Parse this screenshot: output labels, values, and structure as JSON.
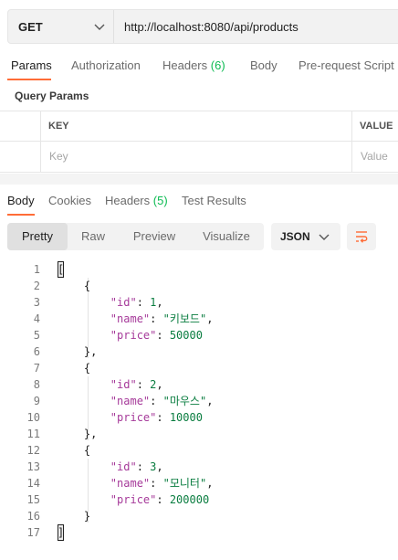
{
  "request": {
    "method": "GET",
    "url": "http://localhost:8080/api/products"
  },
  "request_tabs": [
    {
      "label": "Params"
    },
    {
      "label": "Authorization"
    },
    {
      "label": "Headers",
      "count": "(6)"
    },
    {
      "label": "Body"
    },
    {
      "label": "Pre-request Script"
    }
  ],
  "query_params": {
    "title": "Query Params",
    "key_header": "KEY",
    "value_header": "VALUE",
    "key_placeholder": "Key",
    "value_placeholder": "Value"
  },
  "response_tabs": [
    {
      "label": "Body"
    },
    {
      "label": "Cookies"
    },
    {
      "label": "Headers",
      "count": "(5)"
    },
    {
      "label": "Test Results"
    }
  ],
  "view_modes": [
    "Pretty",
    "Raw",
    "Preview",
    "Visualize"
  ],
  "format": "JSON",
  "icons": {
    "method_dropdown": "chevron-down-icon",
    "format_dropdown": "chevron-down-icon",
    "wrap": "wrap-lines-icon"
  },
  "colors": {
    "accent": "#ff6c37",
    "count": "#0cbb52",
    "json_key": "#a63a9a",
    "json_value": "#0a7d40"
  },
  "response_body": [
    {
      "id": "1",
      "name": "\"키보드\"",
      "price": "50000"
    },
    {
      "id": "2",
      "name": "\"마우스\"",
      "price": "10000"
    },
    {
      "id": "3",
      "name": "\"모니터\"",
      "price": "200000"
    }
  ],
  "json_keys": {
    "id": "\"id\"",
    "name": "\"name\"",
    "price": "\"price\""
  },
  "line_numbers": [
    "1",
    "2",
    "3",
    "4",
    "5",
    "6",
    "7",
    "8",
    "9",
    "10",
    "11",
    "12",
    "13",
    "14",
    "15",
    "16",
    "17"
  ]
}
